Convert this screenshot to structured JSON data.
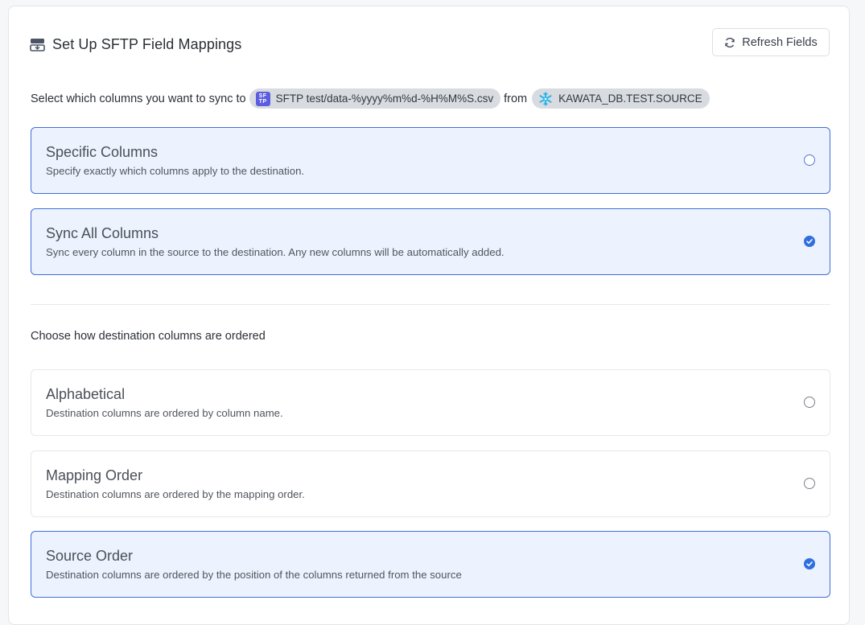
{
  "header": {
    "title": "Set Up SFTP Field Mappings",
    "icon": "mapping-icon",
    "refresh_label": "Refresh Fields"
  },
  "sync": {
    "prefix": "Select which columns you want to sync to",
    "destination_chip": {
      "icon_text_top": "SF",
      "icon_text_bottom": "TP",
      "label": "SFTP test/data-%yyyy%m%d-%H%M%S.csv"
    },
    "middle": "from",
    "source_chip": {
      "icon": "snowflake-icon",
      "label": "KAWATA_DB.TEST.SOURCE"
    }
  },
  "column_options": [
    {
      "title": "Specific Columns",
      "description": "Specify exactly which columns apply to the destination.",
      "selected": false
    },
    {
      "title": "Sync All Columns",
      "description": "Sync every column in the source to the destination. Any new columns will be automatically added.",
      "selected": true
    }
  ],
  "ordering": {
    "label": "Choose how destination columns are ordered",
    "options": [
      {
        "title": "Alphabetical",
        "description": "Destination columns are ordered by column name.",
        "selected": false
      },
      {
        "title": "Mapping Order",
        "description": "Destination columns are ordered by the mapping order.",
        "selected": false
      },
      {
        "title": "Source Order",
        "description": "Destination columns are ordered by the position of the columns returned from the source",
        "selected": true
      }
    ]
  },
  "colors": {
    "accent": "#2f6fe0",
    "selected_bg": "#edf3fe",
    "selected_border": "#3f6fd8",
    "sftp_icon": "#5b5ce0",
    "snowflake": "#29b5e8"
  }
}
